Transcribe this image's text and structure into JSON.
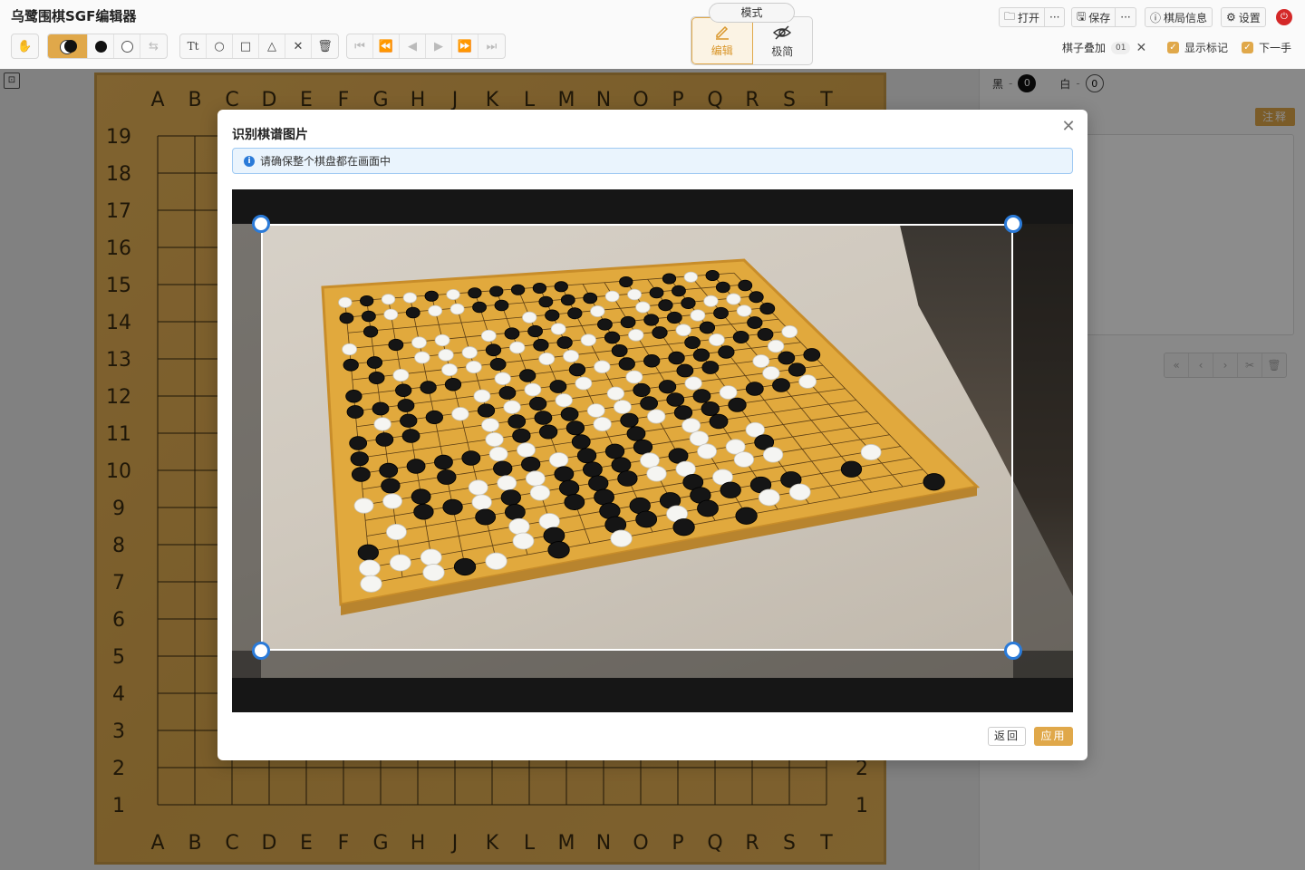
{
  "app": {
    "title": "乌鹭围棋SGF编辑器"
  },
  "toolbar": {
    "tools": [
      "hand",
      "alternate-stone",
      "black-stone",
      "white-stone",
      "swap",
      "text",
      "circle",
      "square",
      "triangle",
      "cross",
      "delete"
    ],
    "nav": [
      "first",
      "prev-branch",
      "prev",
      "next",
      "next-branch",
      "last"
    ]
  },
  "mode": {
    "label": "模式",
    "edit": "编辑",
    "minimal": "极简"
  },
  "header_right": {
    "open": "打开",
    "save": "保存",
    "more": "···",
    "game_info": "棋局信息",
    "settings": "设置"
  },
  "overlay": {
    "stone_overlay_label": "棋子叠加",
    "stone_overlay_value": "01",
    "show_marks": "显示标记",
    "next_move": "下一手"
  },
  "captures": {
    "black_label": "黑",
    "black_count": "0",
    "white_label": "白",
    "white_count": "0"
  },
  "notes": {
    "tag": "注释"
  },
  "board": {
    "cols": [
      "A",
      "B",
      "C",
      "D",
      "E",
      "F",
      "G",
      "H",
      "J",
      "K",
      "L",
      "M",
      "N",
      "O",
      "P",
      "Q",
      "R",
      "S",
      "T"
    ],
    "rows": [
      "19",
      "18",
      "17",
      "16",
      "15",
      "14",
      "13",
      "12",
      "11",
      "10",
      "9",
      "8",
      "7",
      "6",
      "5",
      "4",
      "3",
      "2",
      "1"
    ]
  },
  "modal": {
    "title": "识别棋谱图片",
    "info": "请确保整个棋盘都在画面中",
    "back": "返回",
    "apply": "应用"
  },
  "colors": {
    "accent": "#e0a84a",
    "info_blue": "#2a7ad8",
    "board": "#e4b055"
  }
}
